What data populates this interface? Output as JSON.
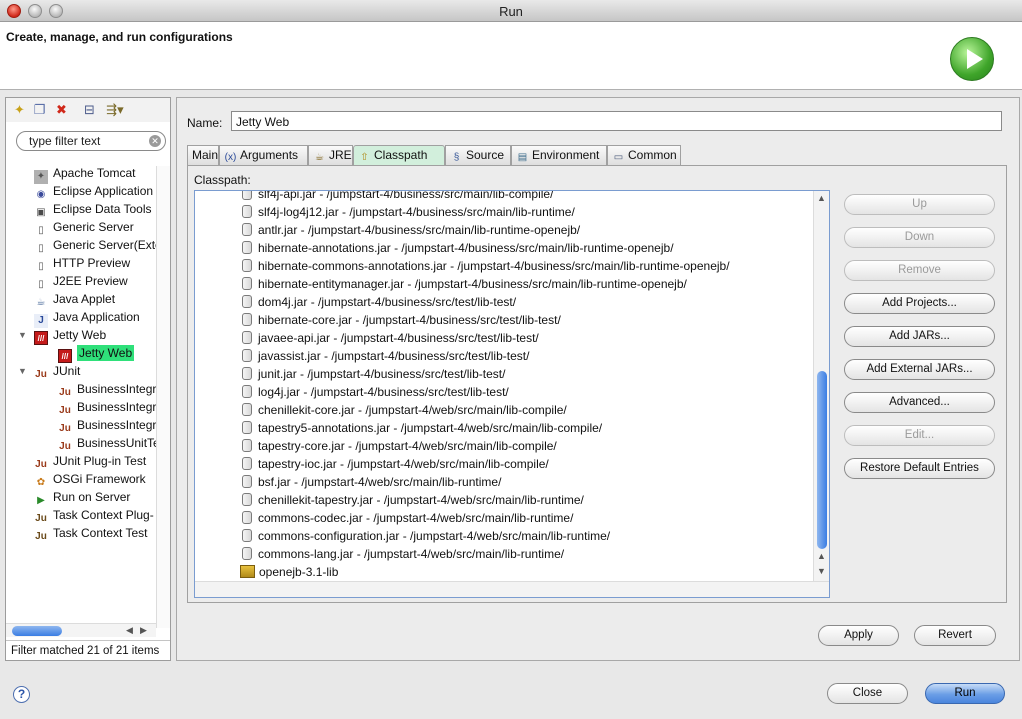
{
  "window": {
    "title": "Run"
  },
  "banner": {
    "title": "Create, manage, and run configurations"
  },
  "left_panel": {
    "filter_placeholder": "type filter text",
    "tree": [
      {
        "label": "Apache Tomcat",
        "icon": "tomcat-icon",
        "level": 1
      },
      {
        "label": "Eclipse Application",
        "icon": "eclipse-icon",
        "level": 1
      },
      {
        "label": "Eclipse Data Tools",
        "icon": "data-tools-icon",
        "level": 1
      },
      {
        "label": "Generic Server",
        "icon": "server-icon",
        "level": 1
      },
      {
        "label": "Generic Server(Exte",
        "icon": "server-icon",
        "level": 1
      },
      {
        "label": "HTTP Preview",
        "icon": "server-icon",
        "level": 1
      },
      {
        "label": "J2EE Preview",
        "icon": "server-icon",
        "level": 1
      },
      {
        "label": "Java Applet",
        "icon": "applet-icon",
        "level": 1
      },
      {
        "label": "Java Application",
        "icon": "java-app-icon",
        "level": 1
      },
      {
        "label": "Jetty Web",
        "icon": "jetty-icon",
        "level": 1,
        "expanded": true
      },
      {
        "label": "Jetty Web",
        "icon": "jetty-icon",
        "level": 2,
        "selected": true
      },
      {
        "label": "JUnit",
        "icon": "junit-icon",
        "level": 1,
        "expanded": true
      },
      {
        "label": "BusinessIntegr",
        "icon": "junit-icon",
        "level": 2
      },
      {
        "label": "BusinessIntegr",
        "icon": "junit-icon",
        "level": 2
      },
      {
        "label": "BusinessIntegr",
        "icon": "junit-icon",
        "level": 2
      },
      {
        "label": "BusinessUnitTe",
        "icon": "junit-icon",
        "level": 2
      },
      {
        "label": "JUnit Plug-in Test",
        "icon": "junit-plugin-icon",
        "level": 1
      },
      {
        "label": "OSGi Framework",
        "icon": "osgi-icon",
        "level": 1
      },
      {
        "label": "Run on Server",
        "icon": "run-server-icon",
        "level": 1
      },
      {
        "label": "Task Context Plug-",
        "icon": "task-context-icon",
        "level": 1
      },
      {
        "label": "Task Context Test",
        "icon": "task-context-icon",
        "level": 1
      }
    ],
    "filter_status": "Filter matched 21 of 21 items"
  },
  "config": {
    "name_label": "Name:",
    "name_value": "Jetty Web",
    "tabs": [
      {
        "label": "Main",
        "icon": ""
      },
      {
        "label": "Arguments",
        "icon": "arguments-icon"
      },
      {
        "label": "JRE",
        "icon": "jre-icon"
      },
      {
        "label": "Classpath",
        "icon": "classpath-icon",
        "active": true
      },
      {
        "label": "Source",
        "icon": "source-icon"
      },
      {
        "label": "Environment",
        "icon": "environment-icon"
      },
      {
        "label": "Common",
        "icon": "common-icon"
      }
    ],
    "classpath_label": "Classpath:",
    "classpath_entries": [
      "slf4j-api.jar - /jumpstart-4/business/src/main/lib-compile/",
      "slf4j-log4j12.jar - /jumpstart-4/business/src/main/lib-runtime/",
      "antlr.jar - /jumpstart-4/business/src/main/lib-runtime-openejb/",
      "hibernate-annotations.jar - /jumpstart-4/business/src/main/lib-runtime-openejb/",
      "hibernate-commons-annotations.jar - /jumpstart-4/business/src/main/lib-runtime-openejb/",
      "hibernate-entitymanager.jar - /jumpstart-4/business/src/main/lib-runtime-openejb/",
      "dom4j.jar - /jumpstart-4/business/src/test/lib-test/",
      "hibernate-core.jar - /jumpstart-4/business/src/test/lib-test/",
      "javaee-api.jar - /jumpstart-4/business/src/test/lib-test/",
      "javassist.jar - /jumpstart-4/business/src/test/lib-test/",
      "junit.jar - /jumpstart-4/business/src/test/lib-test/",
      "log4j.jar - /jumpstart-4/business/src/test/lib-test/",
      "chenillekit-core.jar - /jumpstart-4/web/src/main/lib-compile/",
      "tapestry5-annotations.jar - /jumpstart-4/web/src/main/lib-compile/",
      "tapestry-core.jar - /jumpstart-4/web/src/main/lib-compile/",
      "tapestry-ioc.jar - /jumpstart-4/web/src/main/lib-compile/",
      "bsf.jar - /jumpstart-4/web/src/main/lib-runtime/",
      "chenillekit-tapestry.jar - /jumpstart-4/web/src/main/lib-runtime/",
      "commons-codec.jar - /jumpstart-4/web/src/main/lib-runtime/",
      "commons-configuration.jar - /jumpstart-4/web/src/main/lib-runtime/",
      "commons-lang.jar - /jumpstart-4/web/src/main/lib-runtime/"
    ],
    "classpath_library": "openejb-3.1-lib",
    "buttons": {
      "up": "Up",
      "down": "Down",
      "remove": "Remove",
      "add_projects": "Add Projects...",
      "add_jars": "Add JARs...",
      "add_external_jars": "Add External JARs...",
      "advanced": "Advanced...",
      "edit": "Edit...",
      "restore": "Restore Default Entries"
    },
    "apply": "Apply",
    "revert": "Revert"
  },
  "footer": {
    "help": "?",
    "close": "Close",
    "run": "Run"
  }
}
